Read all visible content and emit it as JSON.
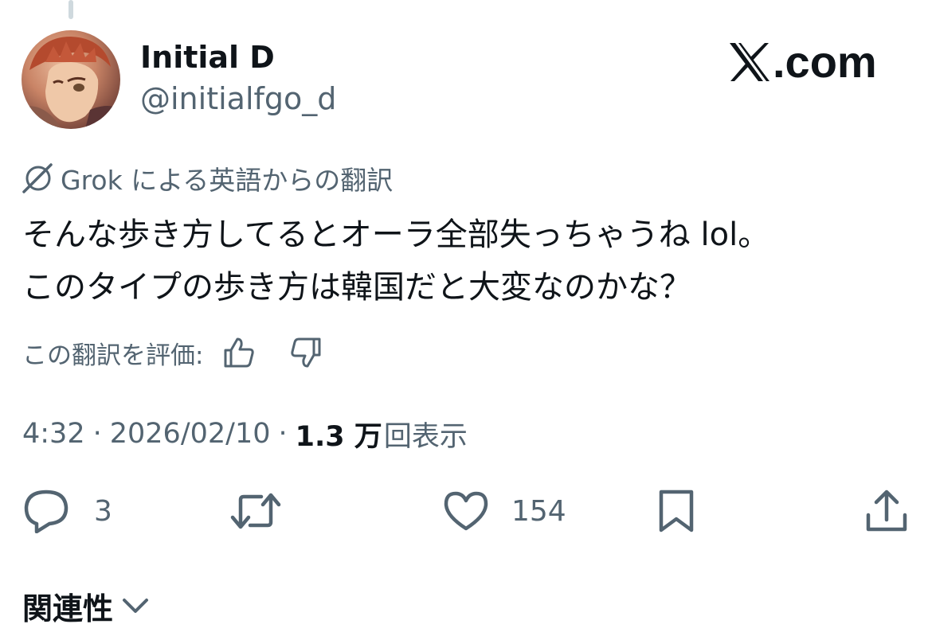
{
  "author": {
    "display_name": "Initial D",
    "handle": "@initialfgo_d"
  },
  "brand": {
    "text": ".com",
    "icon": "x-logo-icon"
  },
  "translation": {
    "icon": "grok-icon",
    "label": "Grok による英語からの翻訳"
  },
  "tweet": {
    "lines": [
      "そんな歩き方してるとオーラ全部失っちゃうね lol。",
      "このタイプの歩き方は韓国だと大変なのかな？"
    ]
  },
  "rating": {
    "label": "この翻訳を評価:",
    "up_icon": "thumbs-up-icon",
    "down_icon": "thumbs-down-icon"
  },
  "meta": {
    "time": "4:32",
    "separator": "·",
    "date": "2026/02/10",
    "views_count": "1.3 万",
    "views_label": "回表示"
  },
  "actions": {
    "reply": {
      "icon": "reply-icon",
      "count": "3"
    },
    "repost": {
      "icon": "repost-icon",
      "count": ""
    },
    "like": {
      "icon": "heart-icon",
      "count": "154"
    },
    "bookmark": {
      "icon": "bookmark-icon"
    },
    "share": {
      "icon": "share-icon"
    }
  },
  "related": {
    "label": "関連性",
    "icon": "chevron-down-icon"
  },
  "colors": {
    "text_primary": "#0f1419",
    "text_secondary": "#536471",
    "thread_line": "#cfd9de",
    "background": "#ffffff"
  }
}
